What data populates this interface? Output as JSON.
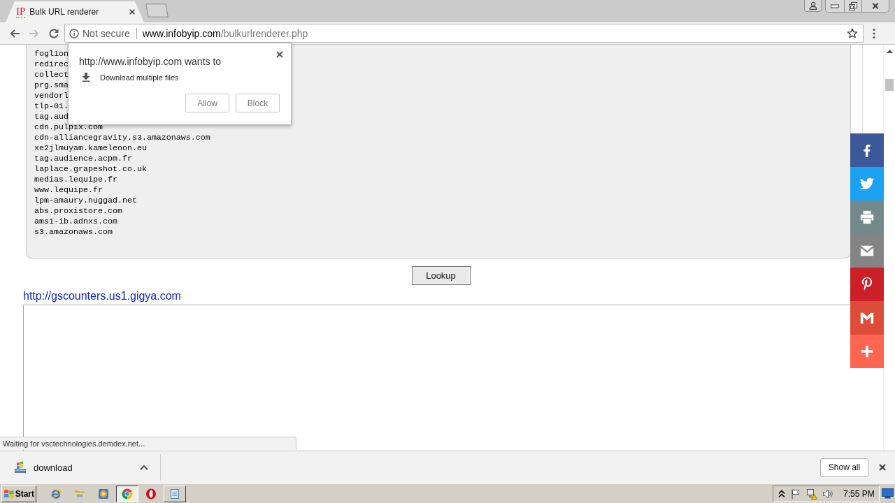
{
  "browser": {
    "tabs": [
      {
        "logo_text": "IP",
        "title": "Bulk URL renderer",
        "selected": true
      }
    ],
    "nav_buttons": [
      {
        "kind": "back",
        "disabled": false
      },
      {
        "kind": "forward",
        "disabled": true
      },
      {
        "kind": "reload",
        "disabled": false
      }
    ],
    "address_bar": {
      "security": "Not secure",
      "host": "www.infobyip.com",
      "path": "/bulkurlrenderer.php"
    }
  },
  "page": {
    "url_list": [
      "fogl1on",
      "redirec",
      "collect",
      "prg.sma",
      "vendorl",
      "tlp-01.",
      "tag.aud",
      "cdn.pulpix.com",
      "cdn-alliancegravity.s3.amazonaws.com",
      "xe2jlmuyam.kameleoon.eu",
      "tag.audience.acpm.fr",
      "laplace.grapeshot.co.uk",
      "medias.lequipe.fr",
      "www.lequipe.fr",
      "lpm-amaury.nuggad.net",
      "abs.proxistore.com",
      "ams1-ib.adnxs.com",
      "s3.amazonaws.com"
    ],
    "lookup_button": "Lookup",
    "result_link": "http://gscounters.us1.gigya.com"
  },
  "share_bar": [
    {
      "kind": "facebook",
      "color": "#3b5998"
    },
    {
      "kind": "twitter",
      "color": "#1da1f2"
    },
    {
      "kind": "print",
      "color": "#738a8d"
    },
    {
      "kind": "email",
      "color": "#848484"
    },
    {
      "kind": "pinterest",
      "color": "#cb2027"
    },
    {
      "kind": "gmail",
      "color": "#dd4b39"
    },
    {
      "kind": "more",
      "color": "#ff6550"
    }
  ],
  "permission_popup": {
    "message": "http://www.infobyip.com wants to",
    "permission": "Download multiple files",
    "buttons": [
      "Allow",
      "Block"
    ]
  },
  "status_bubble": "Waiting for vsctechnologies.demdex.net...",
  "download_shelf": {
    "items": [
      {
        "name": "download"
      }
    ],
    "show_all": "Show all"
  },
  "taskbar": {
    "start": "Start",
    "apps": [
      {
        "kind": "ie",
        "running": false,
        "selected": false
      },
      {
        "kind": "explorer",
        "running": false,
        "selected": false
      },
      {
        "kind": "media",
        "running": false,
        "selected": false
      },
      {
        "kind": "chrome",
        "running": true,
        "selected": true
      },
      {
        "kind": "opera",
        "running": false,
        "selected": false
      },
      {
        "kind": "notepad",
        "running": true,
        "selected": false
      }
    ],
    "clock": "7:55 PM"
  }
}
